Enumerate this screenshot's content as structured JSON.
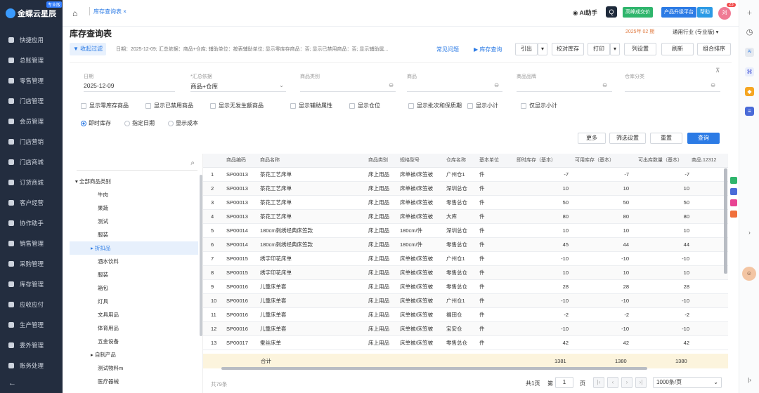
{
  "sidebar": {
    "logo_text": "金蝶云星辰",
    "logo_tag": "专业版",
    "items": [
      "快捷应用",
      "总账管理",
      "零售管理",
      "门店管理",
      "会员管理",
      "门店营销",
      "门店商城",
      "订货商城",
      "客户经营",
      "协作助手",
      "销售管理",
      "采购管理",
      "库存管理",
      "应收应付",
      "生产管理",
      "委外管理",
      "账务处理"
    ],
    "collapse": "←"
  },
  "topbar": {
    "tab_label": "库存查询表 ×",
    "ai_label": "AI助手",
    "btn_high": "高峰成交价",
    "btn_product": "产品升级平台",
    "btn_help": "帮助",
    "avatar_text": "刘",
    "badge": "23"
  },
  "header": {
    "title": "库存查询表",
    "period": "2025年 02 期",
    "company": "通用行业 (专业版) ▾"
  },
  "filterbar": {
    "fold_label": "▼ 收起过滤",
    "summary": "日期：2025-12-09; 汇总依据：商品+仓库; 辅助单位：按表辅助单位; 显示零库存商品：否; 显示已禁用商品：否; 显示辅助属...",
    "common_query": "常见问题",
    "stock_query": "库存查询",
    "btn_export": "引出",
    "btn_verify": "校对库存",
    "btn_print": "打印",
    "btn_columns": "列设置",
    "btn_refresh": "刷新",
    "btn_combo_sort": "组合排序"
  },
  "filters": {
    "date_label": "日期",
    "date_value": "2025-12-09",
    "summary_label": "*汇总依据",
    "summary_value": "商品+仓库",
    "category_label": "商品类别",
    "product_label": "商品",
    "brand_label": "商品品牌",
    "warehouse_label": "仓库分类",
    "checkboxes": [
      "显示零库存商品",
      "显示已禁用商品",
      "显示无发生额商品",
      "显示辅助属性",
      "显示仓位",
      "显示批次和保质期",
      "显示小计",
      "仅显示小计"
    ],
    "radios": [
      "即时库存",
      "指定日期",
      "显示成本"
    ],
    "btn_more": "更多",
    "btn_save_filter": "筛选设置",
    "btn_reset": "重置",
    "btn_query": "查询"
  },
  "tree": {
    "search_placeholder": "",
    "items": [
      {
        "label": "▾ 全部商品类别",
        "indent": 8
      },
      {
        "label": "牛肉",
        "indent": 40
      },
      {
        "label": "果蔬",
        "indent": 40
      },
      {
        "label": "测试",
        "indent": 40
      },
      {
        "label": "服装",
        "indent": 40
      },
      {
        "label": "▸ 折扣品",
        "indent": 30,
        "selected": true
      },
      {
        "label": "酒水饮料",
        "indent": 40
      },
      {
        "label": "服装",
        "indent": 40
      },
      {
        "label": "箱包",
        "indent": 40
      },
      {
        "label": "灯具",
        "indent": 40
      },
      {
        "label": "文具用品",
        "indent": 40
      },
      {
        "label": "体育用品",
        "indent": 40
      },
      {
        "label": "五金设备",
        "indent": 40
      },
      {
        "label": "▸ 自制产品",
        "indent": 30
      },
      {
        "label": "测试物料m",
        "indent": 40
      },
      {
        "label": "医疗器械",
        "indent": 40
      }
    ]
  },
  "grid": {
    "headers": [
      "",
      "商品编码",
      "商品名称",
      "商品类别",
      "规格型号",
      "仓库名称",
      "基本单位",
      "即时库存（基本）",
      "可用库存（基本）",
      "可出库数量（基本）",
      "商品.12312"
    ],
    "rows": [
      [
        "1",
        "SP00013",
        "茶花工艺床单",
        "床上用品",
        "床单被/床笠被",
        "广州仓1",
        "件",
        "-7",
        "-7",
        "-7"
      ],
      [
        "2",
        "SP00013",
        "茶花工艺床单",
        "床上用品",
        "床单被/床笠被",
        "深圳总仓",
        "件",
        "10",
        "10",
        "10"
      ],
      [
        "3",
        "SP00013",
        "茶花工艺床单",
        "床上用品",
        "床单被/床笠被",
        "零售总仓",
        "件",
        "50",
        "50",
        "50"
      ],
      [
        "4",
        "SP00013",
        "茶花工艺床单",
        "床上用品",
        "床单被/床笠被",
        "大库",
        "件",
        "80",
        "80",
        "80"
      ],
      [
        "5",
        "SP00014",
        "180cm刺绣经典床笠款",
        "床上用品",
        "180cm/件",
        "深圳总仓",
        "件",
        "10",
        "10",
        "10"
      ],
      [
        "6",
        "SP00014",
        "180cm刺绣经典床笠款",
        "床上用品",
        "180cm/件",
        "零售总仓",
        "件",
        "45",
        "44",
        "44"
      ],
      [
        "7",
        "SP00015",
        "绣字印花床单",
        "床上用品",
        "床单被/床笠被",
        "广州仓1",
        "件",
        "-10",
        "-10",
        "-10"
      ],
      [
        "8",
        "SP00015",
        "绣字印花床单",
        "床上用品",
        "床单被/床笠被",
        "零售总仓",
        "件",
        "10",
        "10",
        "10"
      ],
      [
        "9",
        "SP00016",
        "儿童床单套",
        "床上用品",
        "床单被/床笠被",
        "零售总仓",
        "件",
        "28",
        "28",
        "28"
      ],
      [
        "10",
        "SP00016",
        "儿童床单套",
        "床上用品",
        "床单被/床笠被",
        "广州仓1",
        "件",
        "-10",
        "-10",
        "-10"
      ],
      [
        "11",
        "SP00016",
        "儿童床单套",
        "床上用品",
        "床单被/床笠被",
        "福田仓",
        "件",
        "-2",
        "-2",
        "-2"
      ],
      [
        "12",
        "SP00016",
        "儿童床单套",
        "床上用品",
        "床单被/床笠被",
        "宝安仓",
        "件",
        "-10",
        "-10",
        "-10"
      ],
      [
        "13",
        "SP00017",
        "蚕丝床单",
        "床上用品",
        "床单被/床笠被",
        "零售总仓",
        "件",
        "42",
        "42",
        "42"
      ]
    ],
    "total_label": "合计",
    "totals": [
      "1381",
      "1380",
      "1380"
    ]
  },
  "footer": {
    "total_count": "共79条",
    "pages_label": "共1页",
    "jump_label": "第",
    "page_value": "1",
    "page_unit": "页",
    "page_size": "1000条/页"
  }
}
